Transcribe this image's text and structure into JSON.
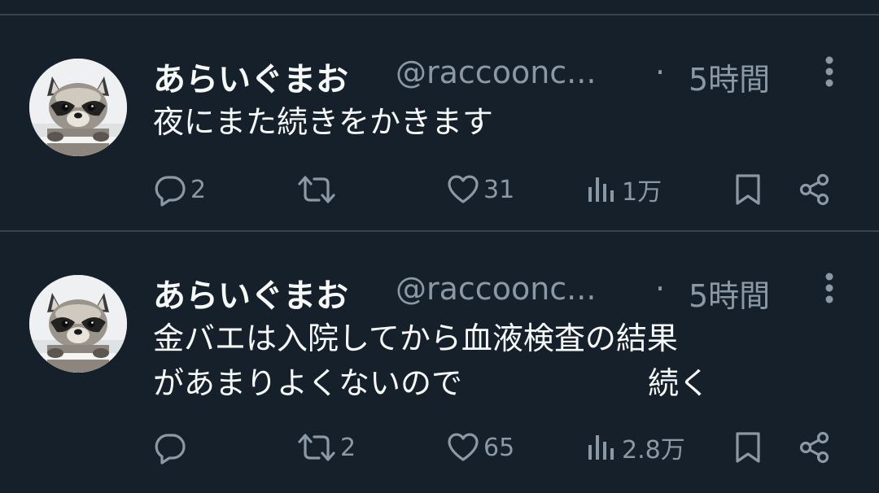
{
  "colors": {
    "background": "#15202b",
    "divider": "#38444d",
    "text_primary": "#f7f9f9",
    "text_secondary": "#8b98a5"
  },
  "tweets": [
    {
      "author": {
        "display_name": "あらいぐまお",
        "handle": "@raccoonc...",
        "avatar": "raccoon-avatar"
      },
      "separator": "·",
      "time": "5時間",
      "text": "夜にまた続きをかきます",
      "actions": {
        "reply_icon": "reply-bubble-icon",
        "reply_count": "2",
        "retweet_icon": "retweet-icon",
        "retweet_count": "",
        "like_icon": "heart-icon",
        "like_count": "31",
        "views_icon": "views-bar-chart-icon",
        "views_count": "1万",
        "bookmark_icon": "bookmark-icon",
        "share_icon": "share-icon"
      }
    },
    {
      "author": {
        "display_name": "あらいぐまお",
        "handle": "@raccoonc...",
        "avatar": "raccoon-avatar"
      },
      "separator": "·",
      "time": "5時間",
      "text": "金バエは入院してから血液検査の結果\nがあまりよくないので　　　　　　続く",
      "actions": {
        "reply_icon": "reply-bubble-icon",
        "reply_count": "",
        "retweet_icon": "retweet-icon",
        "retweet_count": "2",
        "like_icon": "heart-icon",
        "like_count": "65",
        "views_icon": "views-bar-chart-icon",
        "views_count": "2.8万",
        "bookmark_icon": "bookmark-icon",
        "share_icon": "share-icon"
      }
    }
  ]
}
